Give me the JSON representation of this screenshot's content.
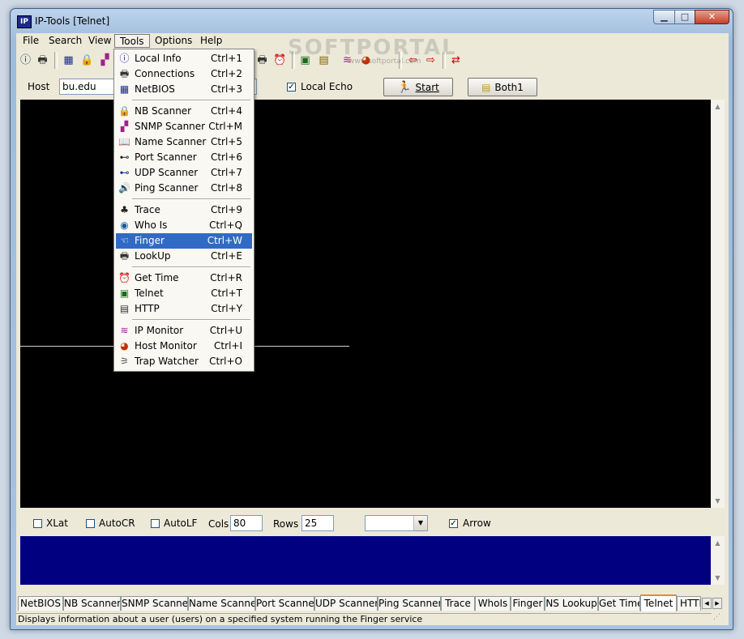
{
  "window": {
    "title": "IP-Tools [Telnet]",
    "app_icon_text": "IP",
    "min": "▁",
    "max": "□",
    "close": "✕"
  },
  "watermark": {
    "big": "SOFTPORTAL",
    "small": "www.softportal.com"
  },
  "menubar": [
    {
      "label": "File"
    },
    {
      "label": "Search"
    },
    {
      "label": "View"
    },
    {
      "label": "Tools"
    },
    {
      "label": "Options"
    },
    {
      "label": "Help"
    }
  ],
  "toolbar_icons": [
    {
      "name": "info-icon",
      "glyph": "ⓘ",
      "color": "#1a2a8a"
    },
    {
      "name": "connections-icon",
      "glyph": "🖶",
      "color": "#333"
    },
    {
      "name": "netbios-icon",
      "glyph": "▦",
      "color": "#1a2a8a"
    },
    {
      "name": "nb-scanner-icon",
      "glyph": "🔒",
      "color": "#806000"
    },
    {
      "name": "snmp-scanner-icon",
      "glyph": "▞",
      "color": "#a02090"
    },
    {
      "name": "printer-icon",
      "glyph": "🖶",
      "color": "#333"
    },
    {
      "name": "clock-icon",
      "glyph": "⏰",
      "color": "#b02000"
    },
    {
      "name": "telnet-icon",
      "glyph": "▣",
      "color": "#1a6a1a"
    },
    {
      "name": "http-icon",
      "glyph": "▤",
      "color": "#806000"
    },
    {
      "name": "ip-monitor-icon",
      "glyph": "≋",
      "color": "#a02090"
    },
    {
      "name": "host-monitor-icon",
      "glyph": "◕",
      "color": "#c03000"
    },
    {
      "name": "back-arrow-icon",
      "glyph": "⇦",
      "color": "#cc0000"
    },
    {
      "name": "forward-arrow-icon",
      "glyph": "⇨",
      "color": "#cc0000"
    },
    {
      "name": "swap-arrows-icon",
      "glyph": "⇄",
      "color": "#cc0000"
    }
  ],
  "hostrow": {
    "host_label": "Host",
    "host_value": "bu.edu",
    "local_echo_label": "Local Echo",
    "local_echo_checked": "✓",
    "start_label": "Start",
    "both_label": "Both1"
  },
  "options": {
    "xlat": "XLat",
    "autocr": "AutoCR",
    "autolf": "AutoLF",
    "cols_label": "Cols",
    "cols_value": "80",
    "rows_label": "Rows",
    "rows_value": "25",
    "combo_value": "",
    "arrow_label": "Arrow",
    "arrow_checked": "✓"
  },
  "tabs": [
    {
      "label": "NetBIOS"
    },
    {
      "label": "NB Scanner"
    },
    {
      "label": "SNMP Scanner"
    },
    {
      "label": "Name Scanner"
    },
    {
      "label": "Port Scanner"
    },
    {
      "label": "UDP Scanner"
    },
    {
      "label": "Ping Scanner"
    },
    {
      "label": "Trace"
    },
    {
      "label": "WhoIs"
    },
    {
      "label": "Finger"
    },
    {
      "label": "NS Lookup"
    },
    {
      "label": "Get Time"
    },
    {
      "label": "Telnet"
    },
    {
      "label": "HTTI"
    }
  ],
  "active_tab": "Telnet",
  "status": "Displays information about a user (users) on a specified system running the Finger service",
  "tools_menu": [
    {
      "label": "Local Info",
      "shortcut": "Ctrl+1",
      "icon": "info-icon",
      "glyph": "ⓘ",
      "color": "#1a2a8a"
    },
    {
      "label": "Connections",
      "shortcut": "Ctrl+2",
      "icon": "connections-icon",
      "glyph": "🖶",
      "color": "#333"
    },
    {
      "label": "NetBIOS",
      "shortcut": "Ctrl+3",
      "icon": "netbios-icon",
      "glyph": "▦",
      "color": "#1a2a8a"
    },
    {
      "sep": true
    },
    {
      "label": "NB Scanner",
      "shortcut": "Ctrl+4",
      "icon": "lock-icon",
      "glyph": "🔒",
      "color": "#806000"
    },
    {
      "label": "SNMP Scanner",
      "shortcut": "Ctrl+M",
      "icon": "network-icon",
      "glyph": "▞",
      "color": "#a02090"
    },
    {
      "label": "Name Scanner",
      "shortcut": "Ctrl+5",
      "icon": "book-icon",
      "glyph": "📖",
      "color": "#1a2a8a"
    },
    {
      "label": "Port Scanner",
      "shortcut": "Ctrl+6",
      "icon": "binoculars-icon",
      "glyph": "⊷",
      "color": "#222"
    },
    {
      "label": "UDP Scanner",
      "shortcut": "Ctrl+7",
      "icon": "binoculars-blue-icon",
      "glyph": "⊷",
      "color": "#1a2a8a"
    },
    {
      "label": "Ping Scanner",
      "shortcut": "Ctrl+8",
      "icon": "speaker-icon",
      "glyph": "🔊",
      "color": "#333"
    },
    {
      "sep": true
    },
    {
      "label": "Trace",
      "shortcut": "Ctrl+9",
      "icon": "trace-icon",
      "glyph": "♣",
      "color": "#222"
    },
    {
      "label": "Who Is",
      "shortcut": "Ctrl+Q",
      "icon": "globe-icon",
      "glyph": "◉",
      "color": "#1a5a9a"
    },
    {
      "label": "Finger",
      "shortcut": "Ctrl+W",
      "icon": "pointing-hand-icon",
      "glyph": "☜",
      "color": "#222"
    },
    {
      "label": "LookUp",
      "shortcut": "Ctrl+E",
      "icon": "lookup-icon",
      "glyph": "🖶",
      "color": "#333"
    },
    {
      "sep": true
    },
    {
      "label": "Get Time",
      "shortcut": "Ctrl+R",
      "icon": "alarm-clock-icon",
      "glyph": "⏰",
      "color": "#b02000"
    },
    {
      "label": "Telnet",
      "shortcut": "Ctrl+T",
      "icon": "monitor-icon",
      "glyph": "▣",
      "color": "#1a6a1a"
    },
    {
      "label": "HTTP",
      "shortcut": "Ctrl+Y",
      "icon": "document-icon",
      "glyph": "▤",
      "color": "#333"
    },
    {
      "sep": true
    },
    {
      "label": "IP Monitor",
      "shortcut": "Ctrl+U",
      "icon": "graph-icon",
      "glyph": "≋",
      "color": "#a02090"
    },
    {
      "label": "Host Monitor",
      "shortcut": "Ctrl+I",
      "icon": "pie-icon",
      "glyph": "◕",
      "color": "#c03000"
    },
    {
      "label": "Trap Watcher",
      "shortcut": "Ctrl+O",
      "icon": "trap-icon",
      "glyph": "⚞",
      "color": "#555"
    }
  ],
  "highlighted_item": "Finger"
}
